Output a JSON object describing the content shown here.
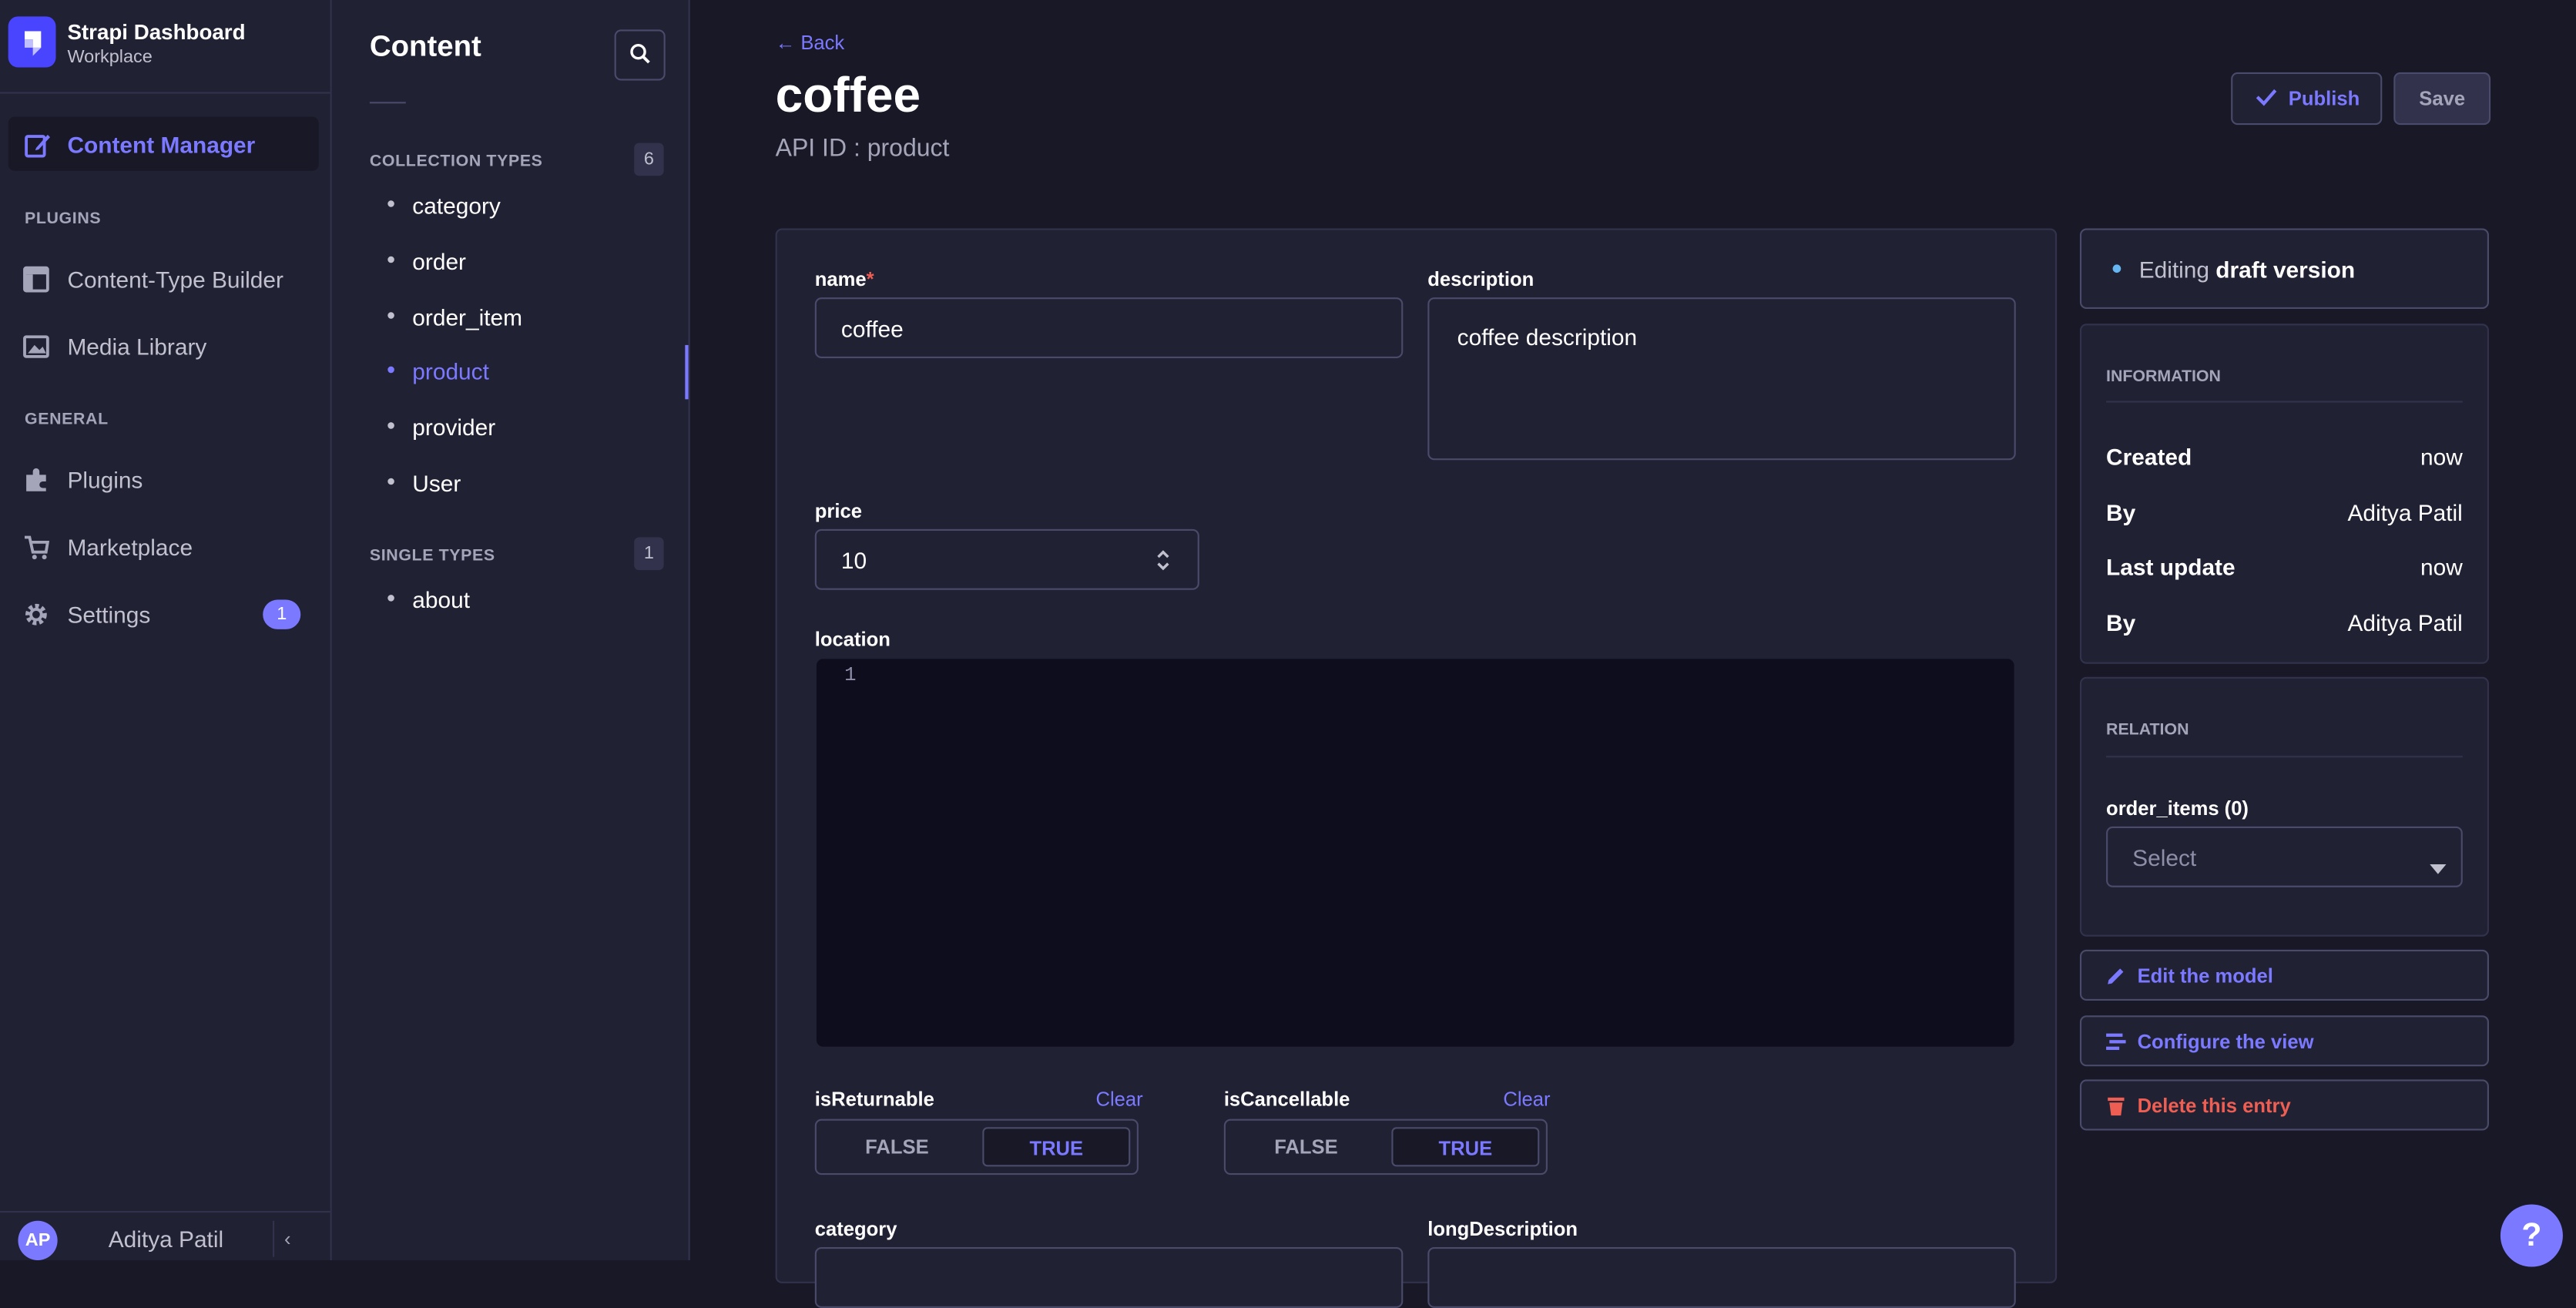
{
  "brand": {
    "title": "Strapi Dashboard",
    "subtitle": "Workplace"
  },
  "nav": {
    "content_manager": "Content Manager",
    "plugins_section": "PLUGINS",
    "content_type_builder": "Content-Type Builder",
    "media_library": "Media Library",
    "general_section": "GENERAL",
    "plugins": "Plugins",
    "marketplace": "Marketplace",
    "settings": "Settings",
    "settings_badge": "1"
  },
  "user": {
    "initials": "AP",
    "name": "Aditya Patil"
  },
  "subnav": {
    "title": "Content",
    "collection_types_label": "COLLECTION TYPES",
    "collection_types_count": "6",
    "collection_types": [
      "category",
      "order",
      "order_item",
      "product",
      "provider",
      "User"
    ],
    "active_item": "product",
    "single_types_label": "SINGLE TYPES",
    "single_types_count": "1",
    "single_types": [
      "about"
    ]
  },
  "header": {
    "back": "Back",
    "title": "coffee",
    "api_id": "API ID : product",
    "publish": "Publish",
    "save": "Save"
  },
  "form": {
    "name_label": "name",
    "name_required": "*",
    "name_value": "coffee",
    "description_label": "description",
    "description_value": "coffee description",
    "price_label": "price",
    "price_value": "10",
    "location_label": "location",
    "location_line_number": "1",
    "is_returnable_label": "isReturnable",
    "is_cancellable_label": "isCancellable",
    "clear": "Clear",
    "toggle_false": "FALSE",
    "toggle_true": "TRUE",
    "is_returnable_value": "TRUE",
    "is_cancellable_value": "TRUE",
    "category_label": "category",
    "long_description_label": "longDescription"
  },
  "sidebar": {
    "editing_prefix": "Editing ",
    "editing_version": "draft version",
    "information_heading": "INFORMATION",
    "info": [
      {
        "key": "Created",
        "value": "now"
      },
      {
        "key": "By",
        "value": "Aditya Patil"
      },
      {
        "key": "Last update",
        "value": "now"
      },
      {
        "key": "By",
        "value": "Aditya Patil"
      }
    ],
    "relation_heading": "RELATION",
    "relation_label": "order_items (0)",
    "relation_placeholder": "Select",
    "edit_model": "Edit the model",
    "configure_view": "Configure the view",
    "delete_entry": "Delete this entry"
  },
  "help": "?",
  "colors": {
    "accent": "#7b79ff",
    "background": "#181826",
    "panel": "#212134",
    "danger": "#ee5e52",
    "info_dot": "#66b7f1"
  }
}
